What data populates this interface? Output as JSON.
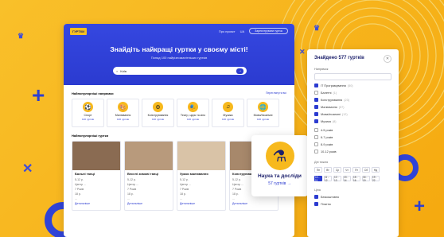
{
  "colors": {
    "brand_blue": "#2b3bd0",
    "accent_yellow": "#f7b91d",
    "navy": "#1b1f6b"
  },
  "header": {
    "logo": "ГУРТКИ",
    "links": [
      "Про проєкт",
      "UA"
    ],
    "cta": "Зареєструвати гурток"
  },
  "hero": {
    "title": "Знайдіть найкращі гуртки у своєму місті!",
    "subtitle": "Понад 100 найрізноманітніших гуртків"
  },
  "search": {
    "value": "Київ",
    "button_icon": "arrow-right-icon"
  },
  "categories_section": {
    "title": "Найпопулярніші напрямки",
    "link": "Переглянути всі",
    "items": [
      {
        "name": "Спорт",
        "count": "100 гуртків",
        "icon": "ball-icon",
        "glyph": "⚽"
      },
      {
        "name": "Малювання",
        "count": "100 гуртків",
        "icon": "palette-icon",
        "glyph": "🎨"
      },
      {
        "name": "Конструювання",
        "count": "100 гуртків",
        "icon": "gear-icon",
        "glyph": "⚙"
      },
      {
        "name": "Театр, цирк та кіно",
        "count": "100 гуртків",
        "icon": "masks-icon",
        "glyph": "🎭"
      },
      {
        "name": "Музика",
        "count": "100 гуртків",
        "icon": "music-icon",
        "glyph": "♫"
      },
      {
        "name": "Мови/Іноземні",
        "count": "100 гуртків",
        "icon": "globe-icon",
        "glyph": "🌐"
      }
    ]
  },
  "clubs_section": {
    "title": "Найпопулярніші гуртки",
    "cards": [
      {
        "title": "Бальні танці",
        "lines": [
          "5-12 р.",
          "Центр ...",
          "7 Років",
          "18 р.",
          "..."
        ],
        "more": "Детальніше",
        "color": "#8a6b52"
      },
      {
        "title": "Веселі зимові танці",
        "lines": [
          "5-12 р.",
          "Центр ...",
          "7 Років",
          "18 р.",
          "..."
        ],
        "more": "Детальніше",
        "color": "#b89a7c"
      },
      {
        "title": "Уроки малювання",
        "lines": [
          "5-12 р.",
          "Центр ...",
          "7 Років",
          "18 р.",
          "..."
        ],
        "more": "Детальніше",
        "color": "#d9c3a7"
      },
      {
        "title": "Конструювання",
        "lines": [
          "5-12 р.",
          "Центр ...",
          "7 Років",
          "18 р.",
          "..."
        ],
        "more": "Детальніше",
        "color": "#a7886b"
      }
    ]
  },
  "popup": {
    "title": "Наука та досліди",
    "count": "57 гуртків",
    "icon": "flask-icon",
    "glyph": "⚗"
  },
  "filters": {
    "title": "Знайдено 577 гуртків",
    "direction_label": "Напрямок",
    "direction_placeholder": "",
    "options": [
      {
        "label": "IT Програмування",
        "count": "(50)",
        "checked": true
      },
      {
        "label": "Балетні",
        "count": "(1)",
        "checked": false
      },
      {
        "label": "Конструювання",
        "count": "(23)",
        "checked": true
      },
      {
        "label": "Малювання",
        "count": "(57)",
        "checked": true
      },
      {
        "label": "Мова/іноземні",
        "count": "(12)",
        "checked": true
      },
      {
        "label": "Музика",
        "count": "(8)",
        "checked": true
      }
    ],
    "age_values": [
      "4-5 років",
      "6-7 років",
      "8-9 років",
      "10-12 років"
    ],
    "days_label": "Дні тижня",
    "days": [
      {
        "label": "Пн",
        "on": false
      },
      {
        "label": "Вт",
        "on": false
      },
      {
        "label": "Ср",
        "on": false
      },
      {
        "label": "Чт",
        "on": false
      },
      {
        "label": "Пт",
        "on": false
      },
      {
        "label": "Сб",
        "on": false
      },
      {
        "label": "Нд",
        "on": false
      }
    ],
    "times": [
      {
        "label": "10 - 11",
        "on": true
      },
      {
        "label": "11 - 12",
        "on": false
      },
      {
        "label": "12 - 13",
        "on": false
      },
      {
        "label": "13 - 14",
        "on": false
      },
      {
        "label": "15 - 16",
        "on": false
      },
      {
        "label": "16 - 19",
        "on": false
      },
      {
        "label": "19 - 22",
        "on": false
      }
    ],
    "price_label": "Ціна",
    "price_options": [
      {
        "label": "Безкоштовно",
        "checked": true
      },
      {
        "label": "Платно",
        "checked": true
      }
    ]
  }
}
